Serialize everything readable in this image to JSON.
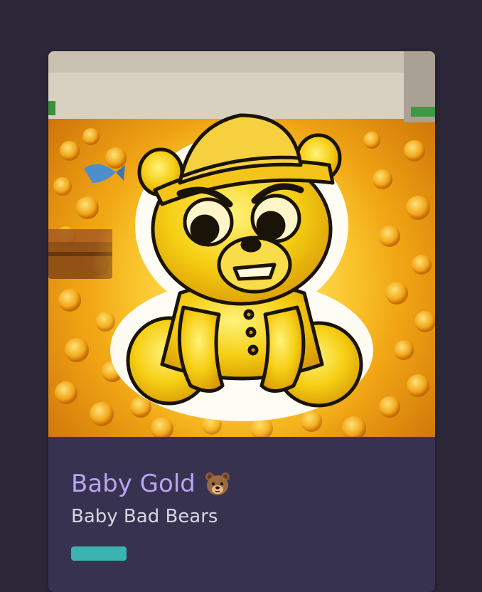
{
  "nft": {
    "name": "Baby Gold",
    "collection": "Baby Bad Bears"
  },
  "icons": {
    "title_emoji": "bear-face-icon"
  },
  "colors": {
    "page_background": "#2b2739",
    "card_background": "#37324f",
    "title": "#b7a4f2",
    "subtitle": "#d8d5e3",
    "badge": "#3bb3b0",
    "gold": "#f4c20f"
  }
}
